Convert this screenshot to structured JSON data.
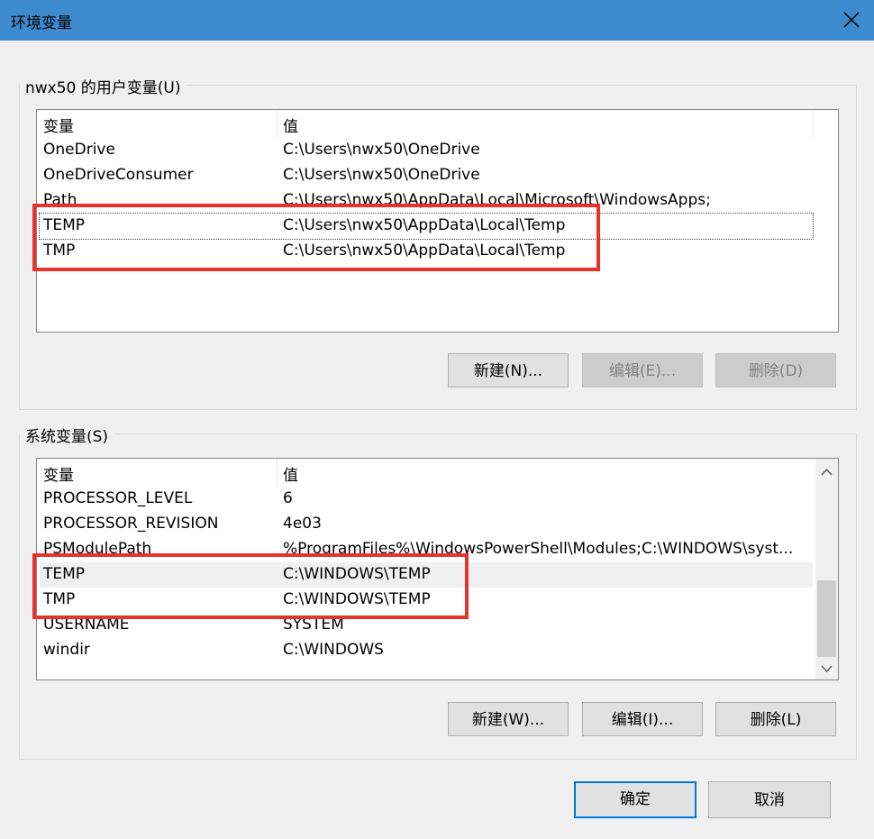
{
  "window": {
    "title": "环境变量"
  },
  "user_vars": {
    "group_label": "nwx50 的用户变量(U)",
    "columns": [
      "变量",
      "值"
    ],
    "rows": [
      {
        "name": "OneDrive",
        "value": "C:\\Users\\nwx50\\OneDrive"
      },
      {
        "name": "OneDriveConsumer",
        "value": "C:\\Users\\nwx50\\OneDrive"
      },
      {
        "name": "Path",
        "value": "C:\\Users\\nwx50\\AppData\\Local\\Microsoft\\WindowsApps;"
      },
      {
        "name": "TEMP",
        "value": "C:\\Users\\nwx50\\AppData\\Local\\Temp"
      },
      {
        "name": "TMP",
        "value": "C:\\Users\\nwx50\\AppData\\Local\\Temp"
      }
    ],
    "buttons": {
      "new": "新建(N)...",
      "edit": "编辑(E)...",
      "delete": "删除(D)"
    }
  },
  "system_vars": {
    "group_label": "系统变量(S)",
    "columns": [
      "变量",
      "值"
    ],
    "rows": [
      {
        "name": "PROCESSOR_LEVEL",
        "value": "6"
      },
      {
        "name": "PROCESSOR_REVISION",
        "value": "4e03"
      },
      {
        "name": "PSModulePath",
        "value": "%ProgramFiles%\\WindowsPowerShell\\Modules;C:\\WINDOWS\\syst..."
      },
      {
        "name": "TEMP",
        "value": "C:\\WINDOWS\\TEMP"
      },
      {
        "name": "TMP",
        "value": "C:\\WINDOWS\\TEMP"
      },
      {
        "name": "USERNAME",
        "value": "SYSTEM"
      },
      {
        "name": "windir",
        "value": "C:\\WINDOWS"
      }
    ],
    "buttons": {
      "new": "新建(W)...",
      "edit": "编辑(I)...",
      "delete": "删除(L)"
    }
  },
  "footer": {
    "ok": "确定",
    "cancel": "取消"
  },
  "colors": {
    "titlebar": "#3d8acf",
    "highlight_box": "#e8332c",
    "default_button_border": "#0078d7"
  },
  "icons": {
    "close": "close-icon",
    "scroll_up": "chevron-up-icon",
    "scroll_down": "chevron-down-icon"
  }
}
